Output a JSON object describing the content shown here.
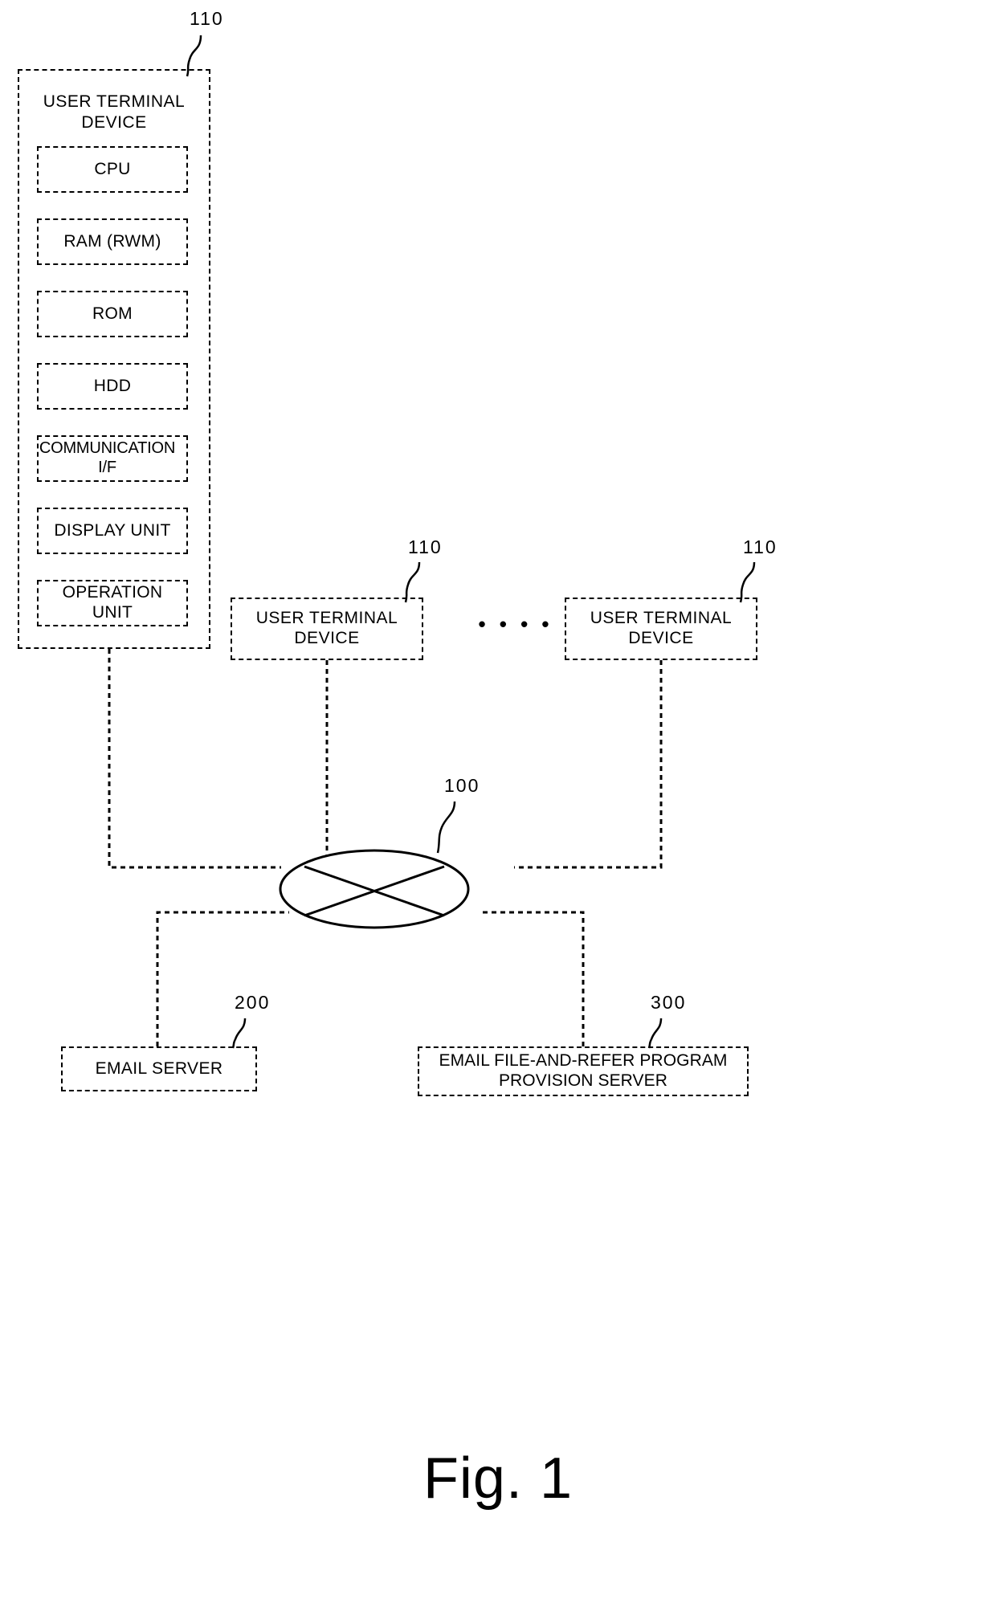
{
  "figure": {
    "caption": "Fig. 1",
    "title": "Network system block diagram"
  },
  "terminal_panel": {
    "title": "USER TERMINAL\nDEVICE",
    "ref": "110",
    "components": [
      {
        "label": "CPU",
        "name": "cpu"
      },
      {
        "label": "RAM (RWM)",
        "name": "ram"
      },
      {
        "label": "ROM",
        "name": "rom"
      },
      {
        "label": "HDD",
        "name": "hdd"
      },
      {
        "label": "COMMUNICATION\nI/F",
        "name": "communication-if"
      },
      {
        "label": "DISPLAY UNIT",
        "name": "display-unit"
      },
      {
        "label": "OPERATION\nUNIT",
        "name": "operation-unit"
      }
    ]
  },
  "peer_terminals": [
    {
      "label": "USER TERMINAL\nDEVICE",
      "ref": "110"
    },
    {
      "label": "USER TERMINAL\nDEVICE",
      "ref": "110"
    }
  ],
  "ellipsis": "• • • •",
  "network": {
    "ref": "100",
    "shape": "ellipse-with-cross"
  },
  "servers": [
    {
      "label": "EMAIL SERVER",
      "ref": "200",
      "name": "email-server"
    },
    {
      "label": "EMAIL FILE-AND-REFER PROGRAM\nPROVISION SERVER",
      "ref": "300",
      "name": "provision-server"
    }
  ],
  "colors": {
    "line": "#000000",
    "background": "#ffffff"
  }
}
